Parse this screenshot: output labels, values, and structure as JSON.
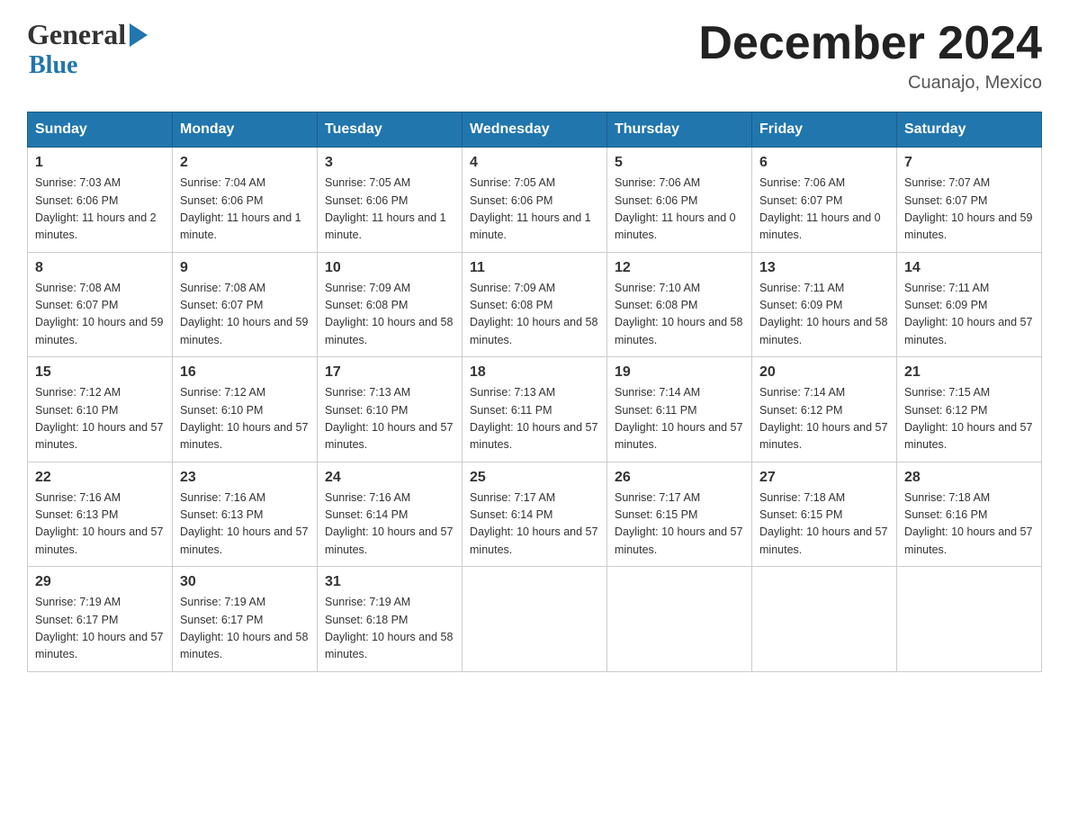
{
  "header": {
    "logo_general": "General",
    "logo_blue": "Blue",
    "month_title": "December 2024",
    "location": "Cuanajo, Mexico"
  },
  "days_of_week": [
    "Sunday",
    "Monday",
    "Tuesday",
    "Wednesday",
    "Thursday",
    "Friday",
    "Saturday"
  ],
  "weeks": [
    [
      {
        "num": "1",
        "sunrise": "7:03 AM",
        "sunset": "6:06 PM",
        "daylight": "11 hours and 2 minutes."
      },
      {
        "num": "2",
        "sunrise": "7:04 AM",
        "sunset": "6:06 PM",
        "daylight": "11 hours and 1 minute."
      },
      {
        "num": "3",
        "sunrise": "7:05 AM",
        "sunset": "6:06 PM",
        "daylight": "11 hours and 1 minute."
      },
      {
        "num": "4",
        "sunrise": "7:05 AM",
        "sunset": "6:06 PM",
        "daylight": "11 hours and 1 minute."
      },
      {
        "num": "5",
        "sunrise": "7:06 AM",
        "sunset": "6:06 PM",
        "daylight": "11 hours and 0 minutes."
      },
      {
        "num": "6",
        "sunrise": "7:06 AM",
        "sunset": "6:07 PM",
        "daylight": "11 hours and 0 minutes."
      },
      {
        "num": "7",
        "sunrise": "7:07 AM",
        "sunset": "6:07 PM",
        "daylight": "10 hours and 59 minutes."
      }
    ],
    [
      {
        "num": "8",
        "sunrise": "7:08 AM",
        "sunset": "6:07 PM",
        "daylight": "10 hours and 59 minutes."
      },
      {
        "num": "9",
        "sunrise": "7:08 AM",
        "sunset": "6:07 PM",
        "daylight": "10 hours and 59 minutes."
      },
      {
        "num": "10",
        "sunrise": "7:09 AM",
        "sunset": "6:08 PM",
        "daylight": "10 hours and 58 minutes."
      },
      {
        "num": "11",
        "sunrise": "7:09 AM",
        "sunset": "6:08 PM",
        "daylight": "10 hours and 58 minutes."
      },
      {
        "num": "12",
        "sunrise": "7:10 AM",
        "sunset": "6:08 PM",
        "daylight": "10 hours and 58 minutes."
      },
      {
        "num": "13",
        "sunrise": "7:11 AM",
        "sunset": "6:09 PM",
        "daylight": "10 hours and 58 minutes."
      },
      {
        "num": "14",
        "sunrise": "7:11 AM",
        "sunset": "6:09 PM",
        "daylight": "10 hours and 57 minutes."
      }
    ],
    [
      {
        "num": "15",
        "sunrise": "7:12 AM",
        "sunset": "6:10 PM",
        "daylight": "10 hours and 57 minutes."
      },
      {
        "num": "16",
        "sunrise": "7:12 AM",
        "sunset": "6:10 PM",
        "daylight": "10 hours and 57 minutes."
      },
      {
        "num": "17",
        "sunrise": "7:13 AM",
        "sunset": "6:10 PM",
        "daylight": "10 hours and 57 minutes."
      },
      {
        "num": "18",
        "sunrise": "7:13 AM",
        "sunset": "6:11 PM",
        "daylight": "10 hours and 57 minutes."
      },
      {
        "num": "19",
        "sunrise": "7:14 AM",
        "sunset": "6:11 PM",
        "daylight": "10 hours and 57 minutes."
      },
      {
        "num": "20",
        "sunrise": "7:14 AM",
        "sunset": "6:12 PM",
        "daylight": "10 hours and 57 minutes."
      },
      {
        "num": "21",
        "sunrise": "7:15 AM",
        "sunset": "6:12 PM",
        "daylight": "10 hours and 57 minutes."
      }
    ],
    [
      {
        "num": "22",
        "sunrise": "7:16 AM",
        "sunset": "6:13 PM",
        "daylight": "10 hours and 57 minutes."
      },
      {
        "num": "23",
        "sunrise": "7:16 AM",
        "sunset": "6:13 PM",
        "daylight": "10 hours and 57 minutes."
      },
      {
        "num": "24",
        "sunrise": "7:16 AM",
        "sunset": "6:14 PM",
        "daylight": "10 hours and 57 minutes."
      },
      {
        "num": "25",
        "sunrise": "7:17 AM",
        "sunset": "6:14 PM",
        "daylight": "10 hours and 57 minutes."
      },
      {
        "num": "26",
        "sunrise": "7:17 AM",
        "sunset": "6:15 PM",
        "daylight": "10 hours and 57 minutes."
      },
      {
        "num": "27",
        "sunrise": "7:18 AM",
        "sunset": "6:15 PM",
        "daylight": "10 hours and 57 minutes."
      },
      {
        "num": "28",
        "sunrise": "7:18 AM",
        "sunset": "6:16 PM",
        "daylight": "10 hours and 57 minutes."
      }
    ],
    [
      {
        "num": "29",
        "sunrise": "7:19 AM",
        "sunset": "6:17 PM",
        "daylight": "10 hours and 57 minutes."
      },
      {
        "num": "30",
        "sunrise": "7:19 AM",
        "sunset": "6:17 PM",
        "daylight": "10 hours and 58 minutes."
      },
      {
        "num": "31",
        "sunrise": "7:19 AM",
        "sunset": "6:18 PM",
        "daylight": "10 hours and 58 minutes."
      },
      null,
      null,
      null,
      null
    ]
  ]
}
